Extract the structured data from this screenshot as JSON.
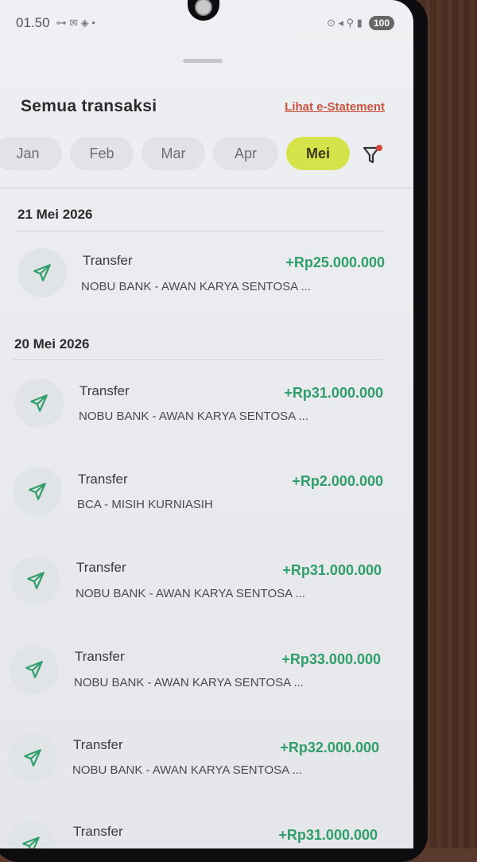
{
  "status_bar": {
    "time": "01.50",
    "left_glyphs": "⊶ ✉ ◈ •",
    "right_glyphs": "⊙ ◂ ⚲ ▮",
    "battery": "100"
  },
  "header": {
    "title": "Semua transaksi",
    "estatement_link": "Lihat e-Statement"
  },
  "months": [
    "Jan",
    "Feb",
    "Mar",
    "Apr",
    "Mei"
  ],
  "selected_month": "Mei",
  "groups": [
    {
      "date": "21 Mei 2026",
      "transactions": [
        {
          "type": "Transfer",
          "amount": "+Rp25.000.000",
          "description": "NOBU BANK - AWAN KARYA SENTOSA ..."
        }
      ]
    },
    {
      "date": "20 Mei 2026",
      "transactions": [
        {
          "type": "Transfer",
          "amount": "+Rp31.000.000",
          "description": "NOBU BANK - AWAN KARYA SENTOSA ..."
        },
        {
          "type": "Transfer",
          "amount": "+Rp2.000.000",
          "description": "BCA - MISIH KURNIASIH"
        },
        {
          "type": "Transfer",
          "amount": "+Rp31.000.000",
          "description": "NOBU BANK - AWAN KARYA SENTOSA ..."
        },
        {
          "type": "Transfer",
          "amount": "+Rp33.000.000",
          "description": "NOBU BANK - AWAN KARYA SENTOSA ..."
        },
        {
          "type": "Transfer",
          "amount": "+Rp32.000.000",
          "description": "NOBU BANK - AWAN KARYA SENTOSA ..."
        },
        {
          "type": "Transfer",
          "amount": "+Rp31.000.000",
          "description": ""
        }
      ]
    }
  ],
  "colors": {
    "accent_pill": "#d6e24a",
    "amount_green": "#2f9e6a",
    "link_red": "#c9543e",
    "icon_green": "#2f9e6a"
  }
}
